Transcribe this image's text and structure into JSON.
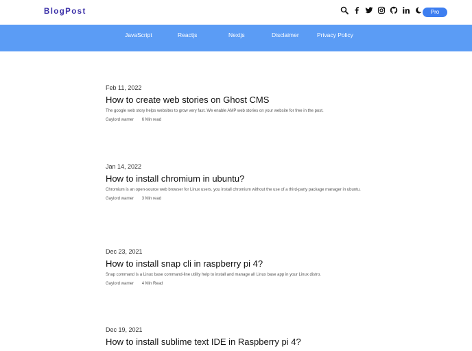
{
  "header": {
    "logo": "BlogPost",
    "pro_label": "Pro",
    "icons": [
      "search-icon",
      "facebook-icon",
      "twitter-icon",
      "instagram-icon",
      "github-icon",
      "linkedin-icon",
      "moon-icon"
    ]
  },
  "nav": {
    "items": [
      {
        "label": "JavaScript"
      },
      {
        "label": "Reactjs"
      },
      {
        "label": "Nextjs"
      },
      {
        "label": "Disclaimer"
      },
      {
        "label": "Privacy Policy"
      }
    ]
  },
  "posts": [
    {
      "date": "Feb 11, 2022",
      "title": "How to create web stories on Ghost CMS",
      "excerpt": "The google web story helps websites to grow very fast. We enable AMP web stories on your website for free in the post.",
      "author": "Gaylord warner",
      "read_time": "6 Min read"
    },
    {
      "date": "Jan 14, 2022",
      "title": "How to install chromium in ubuntu?",
      "excerpt": "Chromium is an open-source web browser for Linux users. you install chromium without the use of a third-party package manager in ubuntu.",
      "author": "Gaylord warner",
      "read_time": "3 Min read"
    },
    {
      "date": "Dec 23, 2021",
      "title": "How to install snap cli in raspberry pi 4?",
      "excerpt": "Snap command is a Linux base command-line utility help to install and manage all Linux base app in your Linux distro.",
      "author": "Gaylord warner",
      "read_time": "4 Min Read"
    },
    {
      "date": "Dec 19, 2021",
      "title": "How to install sublime text IDE in Raspberry pi 4?"
    }
  ],
  "colors": {
    "brand": "#3b30a8",
    "nav_bg": "#5b9cf5",
    "pro_button": "#3d7ef0"
  }
}
